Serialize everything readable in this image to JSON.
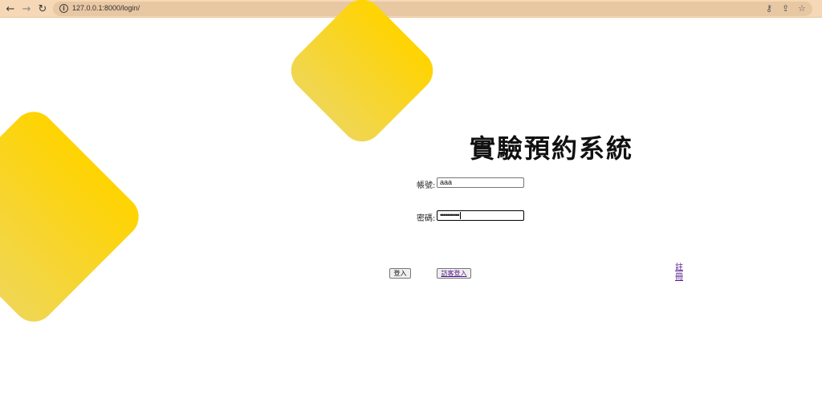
{
  "browser": {
    "url": "127.0.0.1:8000/login/",
    "icons": [
      "back-icon",
      "forward-icon",
      "reload-icon",
      "info-icon",
      "key-icon",
      "share-icon",
      "star-icon"
    ]
  },
  "login": {
    "title": "實驗預約系統",
    "account_label": "帳號:",
    "account_value": "aaa",
    "password_label": "密碼:",
    "password_mask": "•••••••••••",
    "login_button": "登入",
    "guest_login_button": "訪客登入",
    "register_link": "註冊"
  },
  "colors": {
    "accent_yellow": "#ffd400",
    "toolbar_bg": "#f6d8b6",
    "link_purple": "#551a8b"
  }
}
